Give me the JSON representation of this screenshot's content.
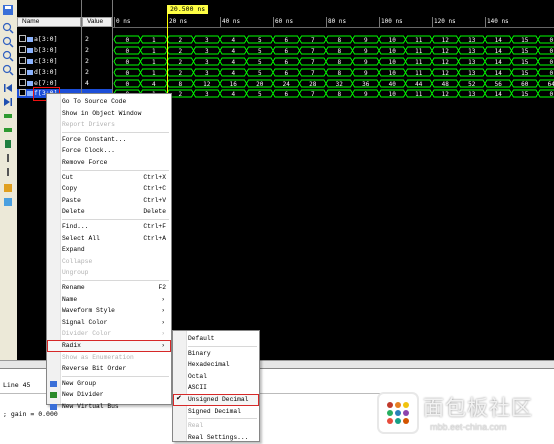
{
  "colors": {
    "accent_red": "#d62828",
    "wave_green": "#00ff00",
    "cursor_yellow": "#ffff44",
    "selection_blue": "#1c4ed8"
  },
  "names_header": "Name",
  "values_header": "Value",
  "cursor_time": "20.500 ns",
  "signals": [
    {
      "name": "a[3:0]",
      "value": "2"
    },
    {
      "name": "b[3:0]",
      "value": "2"
    },
    {
      "name": "c[3:0]",
      "value": "2"
    },
    {
      "name": "d[3:0]",
      "value": "2"
    },
    {
      "name": "e[7:0]",
      "value": "4"
    },
    {
      "name": "f[3:0]",
      "value": ""
    }
  ],
  "time_ticks": [
    "0 ns",
    "20 ns",
    "40 ns",
    "60 ns",
    "80 ns",
    "100 ns",
    "120 ns",
    "140 ns"
  ],
  "wave_rows": [
    [
      "0",
      "1",
      "2",
      "3",
      "4",
      "5",
      "6",
      "7",
      "8",
      "9",
      "10",
      "11",
      "12",
      "13",
      "14",
      "15",
      "0"
    ],
    [
      "0",
      "1",
      "2",
      "3",
      "4",
      "5",
      "6",
      "7",
      "8",
      "9",
      "10",
      "11",
      "12",
      "13",
      "14",
      "15",
      "0"
    ],
    [
      "0",
      "1",
      "2",
      "3",
      "4",
      "5",
      "6",
      "7",
      "8",
      "9",
      "10",
      "11",
      "12",
      "13",
      "14",
      "15",
      "0"
    ],
    [
      "0",
      "1",
      "2",
      "3",
      "4",
      "5",
      "6",
      "7",
      "8",
      "9",
      "10",
      "11",
      "12",
      "13",
      "14",
      "15",
      "0"
    ],
    [
      "0",
      "4",
      "8",
      "12",
      "16",
      "20",
      "24",
      "28",
      "32",
      "36",
      "40",
      "44",
      "48",
      "52",
      "56",
      "60",
      "64"
    ],
    [
      "0",
      "1",
      "2",
      "3",
      "4",
      "5",
      "6",
      "7",
      "8",
      "9",
      "10",
      "11",
      "12",
      "13",
      "14",
      "15",
      "0"
    ]
  ],
  "context_menu": [
    {
      "label": "Go To Source Code",
      "shortcut": "",
      "disabled": false
    },
    {
      "label": "Show in Object Window",
      "shortcut": "",
      "disabled": false
    },
    {
      "label": "Report Drivers",
      "shortcut": "",
      "disabled": true
    },
    {
      "sep": true
    },
    {
      "label": "Force Constant...",
      "shortcut": "",
      "disabled": false
    },
    {
      "label": "Force Clock...",
      "shortcut": "",
      "disabled": false
    },
    {
      "label": "Remove Force",
      "shortcut": "",
      "disabled": false
    },
    {
      "sep": true
    },
    {
      "label": "Cut",
      "shortcut": "Ctrl+X",
      "disabled": false
    },
    {
      "label": "Copy",
      "shortcut": "Ctrl+C",
      "disabled": false
    },
    {
      "label": "Paste",
      "shortcut": "Ctrl+V",
      "disabled": false
    },
    {
      "label": "Delete",
      "shortcut": "Delete",
      "disabled": false
    },
    {
      "sep": true
    },
    {
      "label": "Find...",
      "shortcut": "Ctrl+F",
      "disabled": false
    },
    {
      "label": "Select All",
      "shortcut": "Ctrl+A",
      "disabled": false
    },
    {
      "label": "Expand",
      "shortcut": "",
      "disabled": false
    },
    {
      "label": "Collapse",
      "shortcut": "",
      "disabled": true
    },
    {
      "label": "Ungroup",
      "shortcut": "",
      "disabled": true
    },
    {
      "sep": true
    },
    {
      "label": "Rename",
      "shortcut": "F2",
      "disabled": false
    },
    {
      "label": "Name",
      "shortcut": "",
      "arrow": true,
      "disabled": false
    },
    {
      "label": "Waveform Style",
      "shortcut": "",
      "arrow": true,
      "disabled": false
    },
    {
      "label": "Signal Color",
      "shortcut": "",
      "arrow": true,
      "disabled": false
    },
    {
      "label": "Divider Color",
      "shortcut": "",
      "arrow": true,
      "disabled": true
    },
    {
      "label": "Radix",
      "shortcut": "",
      "arrow": true,
      "disabled": false,
      "highlight": true
    },
    {
      "label": "Show as Enumeration",
      "shortcut": "",
      "disabled": true
    },
    {
      "label": "Reverse Bit Order",
      "shortcut": "",
      "disabled": false
    },
    {
      "sep": true
    },
    {
      "label": "New Group",
      "shortcut": "",
      "disabled": false,
      "icon": true
    },
    {
      "label": "New Divider",
      "shortcut": "",
      "disabled": false,
      "icon": true
    },
    {
      "label": "New Virtual Bus",
      "shortcut": "",
      "disabled": false,
      "icon": true
    }
  ],
  "radix_menu": [
    {
      "label": "Default",
      "disabled": false
    },
    {
      "sep": true
    },
    {
      "label": "Binary",
      "disabled": false
    },
    {
      "label": "Hexadecimal",
      "disabled": false
    },
    {
      "label": "Octal",
      "disabled": false
    },
    {
      "label": "ASCII",
      "disabled": false
    },
    {
      "label": "Unsigned Decimal",
      "disabled": false,
      "checked": true,
      "highlight": true
    },
    {
      "label": "Signed Decimal",
      "disabled": false
    },
    {
      "sep": true
    },
    {
      "label": "Real",
      "disabled": true
    },
    {
      "label": "Real Settings...",
      "disabled": false
    }
  ],
  "console": {
    "line1": "Line 45",
    "line2": "; gain = 0.000"
  },
  "watermark": {
    "title": "面包板社区",
    "url": "mbb.eet-china.com"
  }
}
